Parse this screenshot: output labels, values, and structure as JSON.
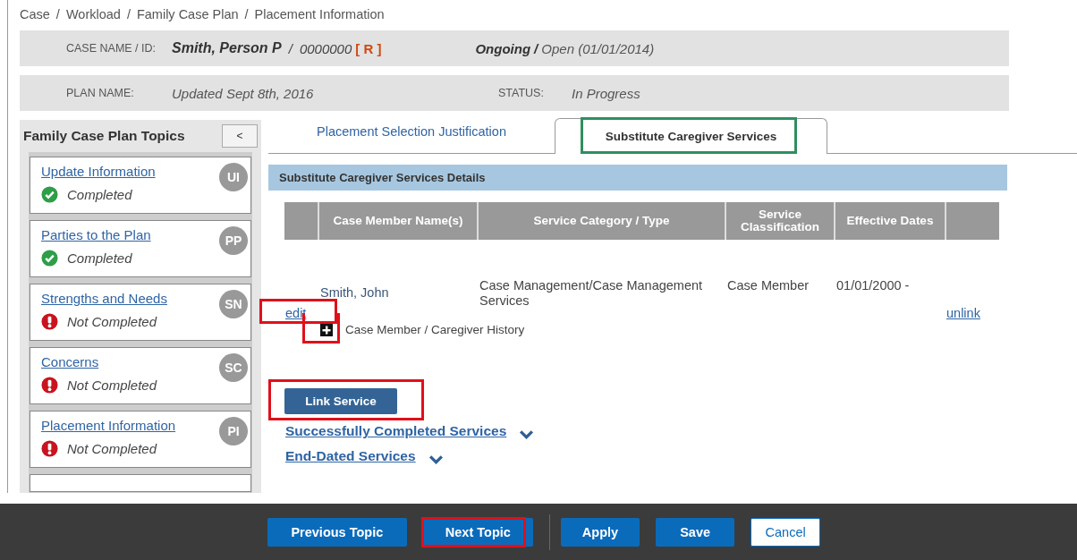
{
  "breadcrumb": {
    "separator": "/",
    "items": [
      "Case",
      "Workload",
      "Family Case Plan",
      "Placement Information"
    ]
  },
  "case_header": {
    "label": "CASE NAME / ID:",
    "name": "Smith, Person P",
    "separator": "/",
    "id": "0000000",
    "flag": "[ R ]",
    "stage": "Ongoing",
    "stage_separator": "/",
    "status": "Open (01/01/2014)"
  },
  "plan_header": {
    "label": "PLAN NAME:",
    "name": "Updated Sept 8th, 2016",
    "status_label": "STATUS:",
    "status": "In Progress"
  },
  "sidebar": {
    "title": "Family Case Plan Topics",
    "collapse_button": "<",
    "topics": [
      {
        "title": "Update Information",
        "initials": "UI",
        "kind": "completed",
        "status": "Completed"
      },
      {
        "title": "Parties to the Plan",
        "initials": "PP",
        "kind": "completed",
        "status": "Completed"
      },
      {
        "title": "Strengths and Needs",
        "initials": "SN",
        "kind": "incomplete",
        "status": "Not Completed"
      },
      {
        "title": "Concerns",
        "initials": "SC",
        "kind": "incomplete",
        "status": "Not Completed"
      },
      {
        "title": "Placement Information",
        "initials": "PI",
        "kind": "incomplete",
        "status": "Not Completed"
      }
    ]
  },
  "tabs": [
    {
      "label": "Placement Selection Justification",
      "selected": false,
      "highlighted": false
    },
    {
      "label": "Substitute Caregiver Services",
      "selected": true,
      "highlighted": true
    }
  ],
  "section_title": "Substitute Caregiver Services Details",
  "table": {
    "columns": [
      "Case Member Name(s)",
      "Service Category / Type",
      "Service Classification",
      "Effective Dates"
    ],
    "rows": [
      {
        "name": "Smith, John",
        "category": "Case Management/Case Management Services",
        "classification": "Case Member",
        "dates": "01/01/2000 -",
        "edit_link": "edit",
        "edit_highlighted": true,
        "unlink": "unlink",
        "expanded": false,
        "expand_highlighted": true,
        "history": "Case Member / Caregiver History"
      }
    ]
  },
  "link_service": {
    "label": "Link Service",
    "highlighted": true
  },
  "collapsible_sections": [
    {
      "label": "Successfully Completed Services",
      "expanded": false
    },
    {
      "label": "End-Dated Services",
      "expanded": false
    }
  ],
  "footer_buttons": [
    {
      "label": "Previous Topic",
      "kind": "primary",
      "highlighted": false
    },
    {
      "label": "Next Topic",
      "kind": "primary",
      "highlighted": true
    },
    {
      "kind": "divider"
    },
    {
      "label": "Apply",
      "kind": "primary",
      "highlighted": false
    },
    {
      "label": "Save",
      "kind": "primary",
      "highlighted": false
    },
    {
      "label": "Cancel",
      "kind": "secondary",
      "highlighted": false
    }
  ]
}
